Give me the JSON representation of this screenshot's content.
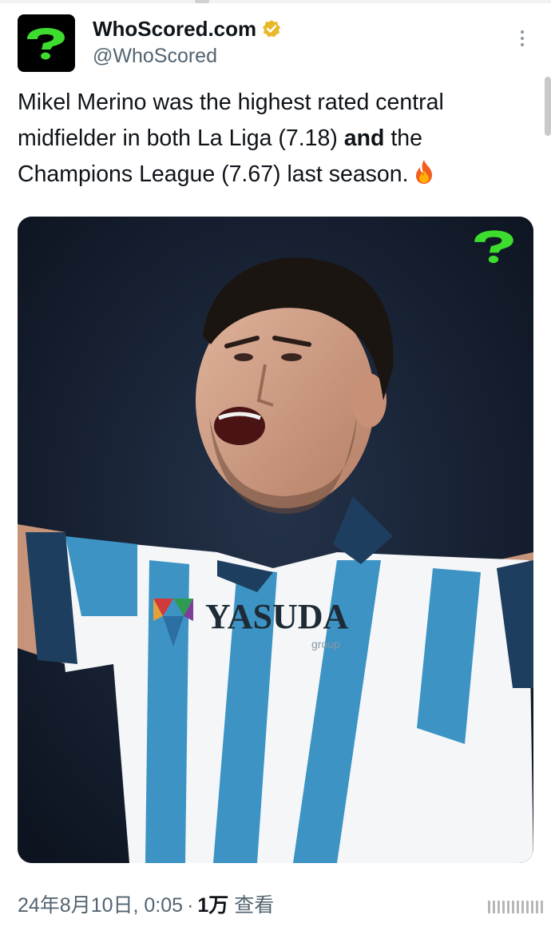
{
  "account": {
    "display_name": "WhoScored.com",
    "handle": "@WhoScored",
    "verified": true,
    "avatar_icon": "question-mark-logo-icon"
  },
  "tweet": {
    "text_part1": "Mikel Merino was the highest rated central midfielder in both La Liga (7.18) ",
    "text_bold": "and",
    "text_part2": " the Champions League (7.67) last season.",
    "emoji_icon": "fire-icon"
  },
  "media": {
    "description_icon": "question-mark-logo-icon",
    "sponsor_text": "YASUDA",
    "sponsor_sub": "group"
  },
  "meta": {
    "datetime": "24年8月10日, 0:05",
    "separator": "·",
    "views_count": "1万",
    "views_label": "查看"
  },
  "colors": {
    "brand_green": "#3ddc2e",
    "text_primary": "#0f1419",
    "text_secondary": "#536471",
    "verified_gold": "#e8b82a"
  }
}
